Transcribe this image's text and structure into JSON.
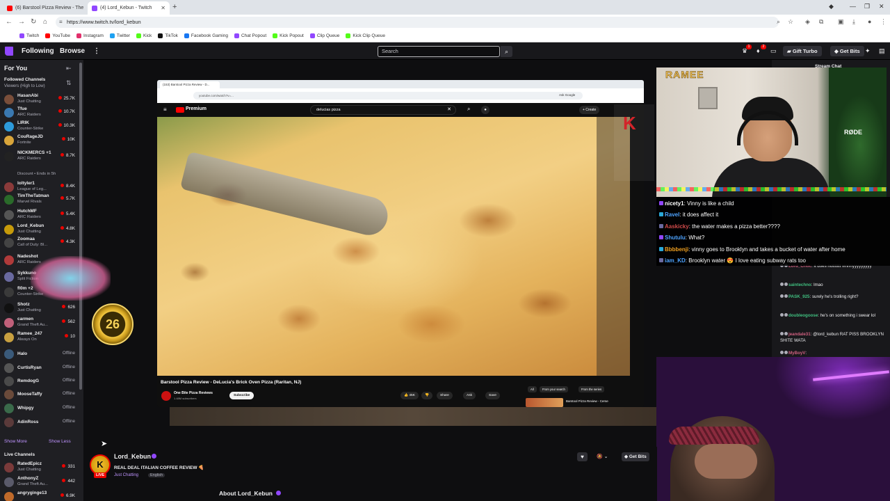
{
  "browser": {
    "tabs": [
      {
        "label": "(6) Barstool Pizza Review - The",
        "active": false
      },
      {
        "label": "(4) Lord_Kebun - Twitch",
        "active": true
      }
    ],
    "url": "https://www.twitch.tv/lord_kebun",
    "bookmarks": [
      "Twitch",
      "YouTube",
      "Instagram",
      "Twitter",
      "Kick",
      "TikTok",
      "Facebook Gaming",
      "Chat Popout",
      "Kick Popout",
      "Clip Queue",
      "Kick Clip Queue"
    ],
    "bookmark_colors": [
      "#9147ff",
      "#ff0000",
      "#e1306c",
      "#1da1f2",
      "#53fc18",
      "#111111",
      "#1877f2",
      "#9147ff",
      "#53fc18",
      "#9147ff",
      "#53fc18"
    ]
  },
  "twitch_nav": {
    "following": "Following",
    "browse": "Browse",
    "more": "⋮",
    "search_placeholder": "Search",
    "gift_turbo": "Gift Turbo",
    "get_bits": "Get Bits"
  },
  "sidebar": {
    "for_you": "For You",
    "followed_title": "Followed Channels",
    "followed_sort": "Viewers (High to Low)",
    "discount_note": "Discount • Ends in 5h",
    "show_more": "Show More",
    "show_less": "Show Less",
    "live_title": "Live Channels",
    "channels": [
      {
        "name": "HasanAbi",
        "game": "Just Chatting",
        "viewers": "25.7K",
        "color": "#7a4e3a"
      },
      {
        "name": "Tfue",
        "game": "ARC Raiders",
        "viewers": "10.7K",
        "color": "#3a78b0"
      },
      {
        "name": "LIRIK",
        "game": "Counter-Strike",
        "viewers": "10.3K",
        "color": "#2d9bdb"
      },
      {
        "name": "CouRageJD",
        "game": "Fortnite",
        "viewers": "10K",
        "color": "#d9a53a"
      },
      {
        "name": "NICKMERCS +1",
        "game": "ARC Raiders",
        "viewers": "8.7K",
        "color": "#222"
      },
      {
        "name": "loltyler1",
        "game": "League of Leg...",
        "viewers": "8.4K",
        "color": "#8a3a3a"
      },
      {
        "name": "TimTheTatman",
        "game": "Marvel Rivals",
        "viewers": "5.7K",
        "color": "#2a6a2a"
      },
      {
        "name": "HutchMF",
        "game": "ARC Raiders",
        "viewers": "5.4K",
        "color": "#555"
      },
      {
        "name": "Lord_Kebun",
        "game": "Just Chatting",
        "viewers": "4.8K",
        "color": "#c69a0a"
      },
      {
        "name": "Zoomaa",
        "game": "Call of Duty: Bl...",
        "viewers": "4.3K",
        "color": "#444"
      },
      {
        "name": "Nadeshot",
        "game": "ARC Raiders",
        "viewers": "",
        "color": "#b03a3a"
      },
      {
        "name": "Sykkuno",
        "game": "Split Fiction",
        "viewers": "",
        "color": "#6a6aa0"
      },
      {
        "name": "fl0m +2",
        "game": "Counter-Strike",
        "viewers": "",
        "color": "#3a3a3a"
      },
      {
        "name": "Shotz",
        "game": "Just Chatting",
        "viewers": "626",
        "color": "#111"
      },
      {
        "name": "carmen",
        "game": "Grand Theft Au...",
        "viewers": "562",
        "color": "#c0607a"
      },
      {
        "name": "Ramee_247",
        "game": "Always On",
        "viewers": "10",
        "color": "#c8a040"
      },
      {
        "name": "Halo",
        "game": "",
        "viewers": "Offline",
        "color": "#3a5a7a"
      },
      {
        "name": "CurtisRyan",
        "game": "",
        "viewers": "Offline",
        "color": "#555"
      },
      {
        "name": "RemdogG",
        "game": "",
        "viewers": "Offline",
        "color": "#4a4a4a"
      },
      {
        "name": "MooseTaffy",
        "game": "",
        "viewers": "Offline",
        "color": "#6a4a3a"
      },
      {
        "name": "Whipgy",
        "game": "",
        "viewers": "Offline",
        "color": "#3a6a4a"
      },
      {
        "name": "AdinRoss",
        "game": "",
        "viewers": "Offline",
        "color": "#5a3a3a"
      }
    ],
    "live_channels": [
      {
        "name": "RatedEpicz",
        "game": "Just Chatting",
        "viewers": "331",
        "color": "#7a3a3a"
      },
      {
        "name": "AnthonyZ",
        "game": "Grand Theft Au...",
        "viewers": "442",
        "color": "#5a5a6a"
      },
      {
        "name": "angryginge13",
        "game": "",
        "viewers": "6.9K",
        "color": "#c06a2a"
      }
    ]
  },
  "inner_browser": {
    "tab": "(153) Barstool Pizza Review - D...",
    "url": "youtube.com/watch?v=...",
    "ask_google": "Ask Google",
    "yt_premium": "Premium",
    "search": "delucias pizza",
    "create": "+ Create",
    "video_title": "Barstool Pizza Review - DeLucia's Brick Oven Pizza (Raritan, NJ)",
    "channel": "One Bite Pizza Reviews",
    "subs": "1.48M subscribers",
    "subscribe": "Subscribe",
    "likes": "45K",
    "share": "Share",
    "ask": "Ask",
    "save": "Save",
    "chips": [
      "All",
      "From your search",
      "From the series"
    ],
    "rec_title": "Barstool Pizza Review - Cerse"
  },
  "overlay": {
    "cam_logo": "RAMEE",
    "rode": "RØDE"
  },
  "overlay_chat": [
    {
      "user": "nicety1",
      "text": "Vinny is like a child",
      "color": "#ffffff"
    },
    {
      "user": "Ravel",
      "text": "it does affect it",
      "color": "#4ea3ff"
    },
    {
      "user": "Aaskicky",
      "text": "the water makes a pizza better????",
      "color": "#d04a4a"
    },
    {
      "user": "Shutulu",
      "text": "What?",
      "color": "#4ea3ff"
    },
    {
      "user": "Bbbbenji",
      "text": "vinny goes to Brooklyn and takes a bucket of water after home",
      "color": "#f0a020"
    },
    {
      "user": "iam_KD",
      "text": "Brooklyn water 😍 I love eating subway rats too",
      "color": "#4ea3ff"
    }
  ],
  "twitch_chat": {
    "title": "Stream Chat",
    "messages": [
      {
        "user": "Lord_Critic",
        "text": "it does nottttttt vinnnyyyyyyyyy",
        "color": "#d06080"
      },
      {
        "user": "saintechno",
        "text": "lmao",
        "color": "#40c080"
      },
      {
        "user": "PASK_925",
        "text": "surely he's trolling right?",
        "color": "#40c080"
      },
      {
        "user": "doubleogoose",
        "text": "he's on something i swear lol",
        "color": "#40c080"
      },
      {
        "user": "jeandale31",
        "text": "@lord_kebun RAT PISS BROOKLYN SHITE WATA",
        "color": "#d06080"
      },
      {
        "user": "MyBoyV",
        "text": "",
        "color": "#d06080"
      }
    ]
  },
  "channel_info": {
    "avatar_letter": "K",
    "live": "LIVE",
    "name": "Lord_Kebun",
    "title": "REAL DEAL ITALIAN COFFEE REVIEW 🍕",
    "category": "Just Chatting",
    "language": "English",
    "about": "About Lord_Kebun",
    "get_bits": "Get Bits"
  },
  "badge": {
    "number": "26"
  }
}
